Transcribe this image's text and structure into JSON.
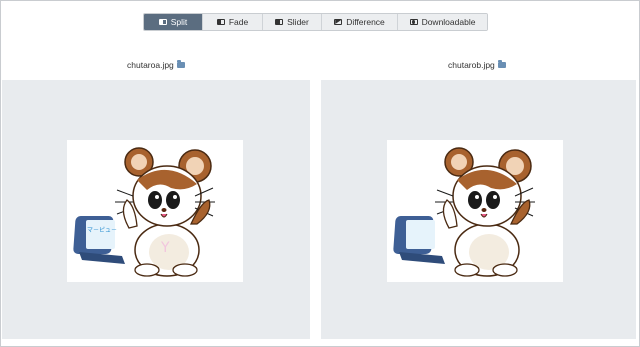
{
  "toolbar": {
    "tabs": [
      {
        "label": "Split",
        "icon": "split-icon",
        "active": true
      },
      {
        "label": "Fade",
        "icon": "fade-icon",
        "active": false
      },
      {
        "label": "Slider",
        "icon": "slider-icon",
        "active": false
      },
      {
        "label": "Difference",
        "icon": "difference-icon",
        "active": false
      },
      {
        "label": "Downloadable",
        "icon": "download-icon",
        "active": false
      }
    ]
  },
  "left": {
    "filename": "chutaroa.jpg",
    "laptop_text": "マ－ピュ－"
  },
  "right": {
    "filename": "chutarob.jpg"
  },
  "colors": {
    "active_tab": "#5b6d80",
    "panel_bg": "#e8ebee",
    "hamster_brown": "#a8622e"
  }
}
